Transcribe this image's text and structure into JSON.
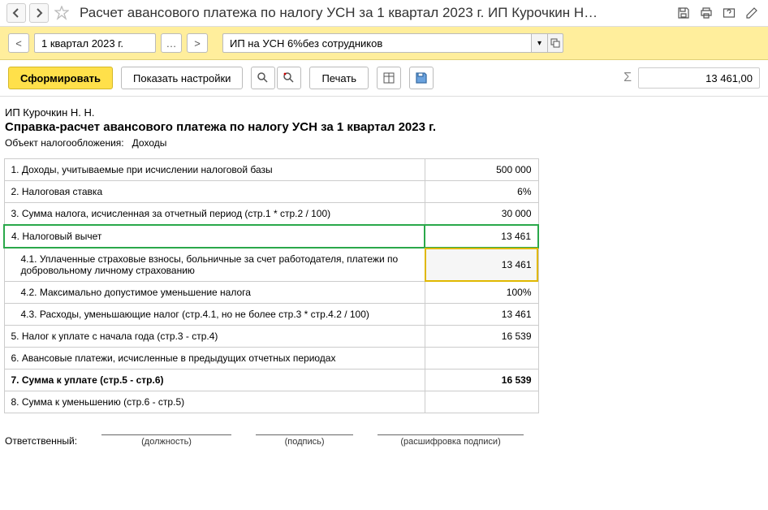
{
  "header": {
    "title": "Расчет  авансового платежа по налогу УСН за 1 квартал 2023 г. ИП Курочкин Н…"
  },
  "filter": {
    "period": "1 квартал 2023 г.",
    "org": "ИП на УСН 6%без сотрудников"
  },
  "toolbar": {
    "form_button": "Сформировать",
    "show_settings": "Показать настройки",
    "print": "Печать",
    "sum_value": "13 461,00"
  },
  "report": {
    "org_name": "ИП Курочкин Н. Н.",
    "title": "Справка-расчет авансового платежа по налогу УСН за 1 квартал 2023 г.",
    "subject_label": "Объект налогообложения:",
    "subject_value": "Доходы",
    "rows": [
      {
        "label": "1. Доходы, учитываемые при исчислении налоговой базы",
        "value": "500 000"
      },
      {
        "label": "2. Налоговая ставка",
        "value": "6%"
      },
      {
        "label": "3. Сумма налога, исчисленная за отчетный период (стр.1 * стр.2 / 100)",
        "value": "30 000"
      },
      {
        "label": "4. Налоговый вычет",
        "value": "13 461"
      },
      {
        "label": "4.1. Уплаченные страховые взносы, больничные за счет работодателя, платежи по добровольному личному страхованию",
        "value": "13 461"
      },
      {
        "label": "4.2. Максимально допустимое уменьшение налога",
        "value": "100%"
      },
      {
        "label": "4.3. Расходы, уменьшающие налог (стр.4.1, но не более стр.3 * стр.4.2 / 100)",
        "value": "13 461"
      },
      {
        "label": "5. Налог к уплате с начала года (стр.3 - стр.4)",
        "value": "16 539"
      },
      {
        "label": "6. Авансовые платежи, исчисленные в предыдущих отчетных периодах",
        "value": ""
      },
      {
        "label": "7. Сумма к уплате (стр.5 - стр.6)",
        "value": "16 539"
      },
      {
        "label": "8. Сумма к уменьшению (стр.6 - стр.5)",
        "value": ""
      }
    ],
    "responsible_label": "Ответственный:",
    "sig_position": "(должность)",
    "sig_sign": "(подпись)",
    "sig_decode": "(расшифровка подписи)"
  }
}
